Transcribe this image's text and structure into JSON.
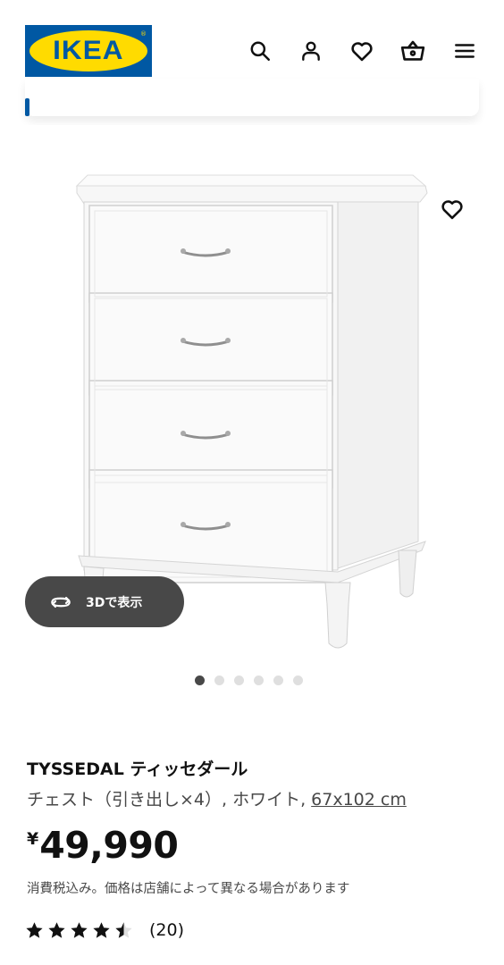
{
  "header": {
    "logo_text": "IKEA",
    "logo_mark": "®",
    "brand_blue": "#0058a3",
    "brand_yellow": "#ffdb00",
    "icons": [
      "search-icon",
      "account-icon",
      "heart-icon",
      "basket-icon",
      "menu-icon"
    ]
  },
  "gallery": {
    "view_3d_label": "3Dで表示",
    "view_3d_icon": "rotate-360-icon",
    "wishlist_icon": "heart-icon",
    "image_count": 6,
    "active_image": 1
  },
  "product": {
    "name": "TYSSEDAL ティッセダール",
    "description": "チェスト（引き出し×4）, ホワイト, ",
    "size": "67x102 cm",
    "currency": "¥",
    "price": "49,990",
    "tax_note": "消費税込み。価格は店舗によって異なる場合があります",
    "rating_value": 4.5,
    "rating_max": 5,
    "review_count": "(20)"
  }
}
